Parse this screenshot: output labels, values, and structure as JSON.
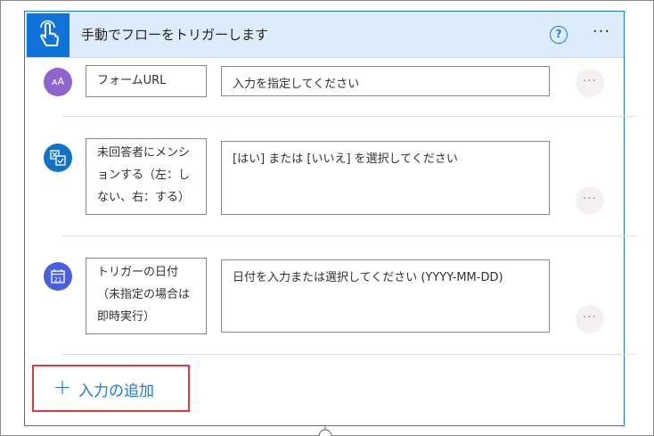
{
  "header": {
    "title": "手動でフローをトリガーします",
    "help_icon": "question-circle-icon",
    "more_label": "···",
    "accent_color": "#0f74d9",
    "header_bg": "#dcecfb"
  },
  "inputs": [
    {
      "icon": "text-input-icon",
      "icon_glyph": "ᴀA",
      "icon_color": "#8e64cf",
      "label_lines": [
        "フォームURL"
      ],
      "placeholder": "入力を指定してください",
      "more_label": "···"
    },
    {
      "icon": "yes-no-icon",
      "icon_color": "#1173c5",
      "label_lines": [
        "未回答者にメンシ",
        "ョンする（左：し",
        "ない、右：する）"
      ],
      "placeholder": "[はい] または [いいえ] を選択してください",
      "more_label": "···"
    },
    {
      "icon": "calendar-icon",
      "icon_glyph": "21",
      "icon_color": "#4a5fe0",
      "label_lines": [
        "トリガーの日付",
        "（未指定の場合は",
        "即時実行）"
      ],
      "placeholder": "日付を入力または選択してください (YYYY-MM-DD)",
      "more_label": "···"
    }
  ],
  "add_input": {
    "plus": "+",
    "label": "入力の追加",
    "highlight_color": "#e23a3a"
  }
}
